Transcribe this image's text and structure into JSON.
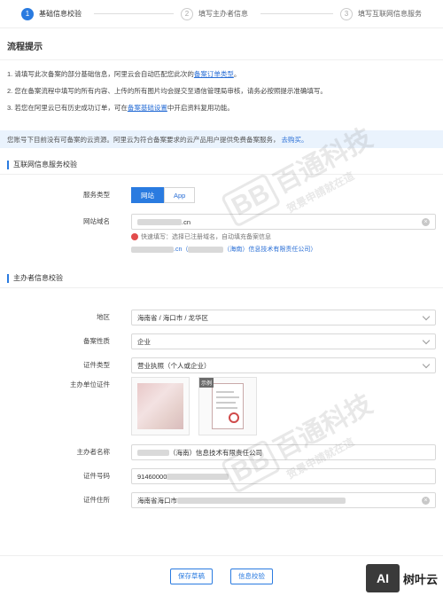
{
  "stepper": {
    "steps": [
      {
        "num": "1",
        "label": "基础信息校验"
      },
      {
        "num": "2",
        "label": "填写主办者信息"
      },
      {
        "num": "3",
        "label": "填写互联网信息服务"
      }
    ]
  },
  "tips": {
    "title": "流程提示",
    "line1_text": "1. 请填写此次备案的部分基础信息，阿里云会自动匹配您此次的",
    "line1_link": "备案订单类型",
    "line1_end": "。",
    "line2_text": "2. 您在备案流程中填写的所有内容、上传的所有图片均会提交至通信管理局审核，请务必按照提示准确填写。",
    "line3_text": "3. 若您在阿里云已有历史成功订单，可在",
    "line3_link": "备案基础设置",
    "line3_end": "中开启资料复用功能。"
  },
  "notice": {
    "text": "您账号下目前没有可备案的云资源。阿里云为符合备案要求的云产品用户提供免费备案服务，",
    "link": "去购买。"
  },
  "section1": {
    "title": "互联网信息服务校验",
    "service_type_label": "服务类型",
    "service_options": [
      "网站",
      "App"
    ],
    "domain_label": "网站域名",
    "domain_value_suffix": ".cn",
    "quick_fill": "快速填写：选择已注册域名，自动填充备案信息",
    "quick_domain_suffix": ".cn（",
    "quick_company": "（海南）信息技术有限责任公司）"
  },
  "section2": {
    "title": "主办者信息校验",
    "region_label": "地区",
    "region_value": "海南省 / 海口市 / 龙华区",
    "nature_label": "备案性质",
    "nature_value": "企业",
    "cert_type_label": "证件类型",
    "cert_type_value": "营业执照（个人或企业）",
    "cert_label": "主办单位证件",
    "example_tag": "示例",
    "name_label": "主办者名称",
    "name_value": "（海南）信息技术有限责任公司",
    "cert_no_label": "证件号码",
    "cert_no_value": "91460000",
    "address_label": "证件住所",
    "address_value": "海南省海口市"
  },
  "footer": {
    "save_label": "保存草稿",
    "verify_label": "信息校验"
  },
  "watermark": {
    "text": "百通科技",
    "sub": "贺景申請就在這"
  },
  "brand": {
    "logo": "AI",
    "name": "树叶云"
  }
}
